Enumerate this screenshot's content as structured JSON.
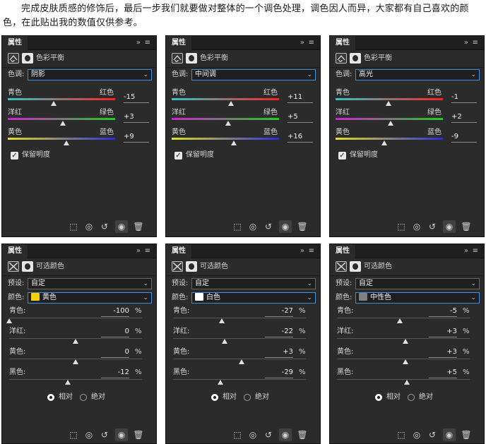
{
  "intro": {
    "text": "完成皮肤质感的修饰后，最后一步我们就要做对整体的一个调色处理，调色因人而异，大家都有自己喜欢的颜色，在此贴出我的数值仅供参考。"
  },
  "colors": {
    "panel_bg": "#2b2b2b",
    "accent_focus": "#3d8de0",
    "yellow_swatch": "#f2d20a",
    "white_swatch": "#ffffff",
    "neutral_swatch": "#808080"
  },
  "panel_common": {
    "tab_title": "属性",
    "collapse_glyph": "»",
    "menu_glyph": "≡",
    "footer_icons": [
      "clip-to-layer-icon",
      "view-previous-state-icon",
      "reset-icon",
      "visibility-eye-icon",
      "delete-icon"
    ]
  },
  "color_balance": {
    "header_title": "色彩平衡",
    "tone_label": "色调:",
    "preserve_label": "保留明度",
    "slider_pairs": [
      {
        "left": "青色",
        "right": "红色"
      },
      {
        "left": "洋红",
        "right": "绿色"
      },
      {
        "left": "黄色",
        "right": "蓝色"
      }
    ],
    "panels": [
      {
        "tone": "阴影",
        "values": [
          "-15",
          "+3",
          "+9"
        ],
        "preserve": true
      },
      {
        "tone": "中间调",
        "values": [
          "+11",
          "+5",
          "+16"
        ],
        "preserve": true
      },
      {
        "tone": "高光",
        "values": [
          "-1",
          "+2",
          "-9"
        ],
        "preserve": true
      }
    ]
  },
  "selective_color": {
    "header_title": "可选颜色",
    "preset_label": "预设:",
    "preset_value": "自定",
    "color_label": "颜色:",
    "slider_labels": [
      "青色:",
      "洋红:",
      "黄色:",
      "黑色:"
    ],
    "percent": "%",
    "relative_label": "相对",
    "absolute_label": "绝对",
    "method": "relative",
    "panels": [
      {
        "color": "黄色",
        "swatch": "yellow",
        "values": [
          "-100",
          "0",
          "0",
          "-12"
        ]
      },
      {
        "color": "白色",
        "swatch": "white",
        "values": [
          "-27",
          "-22",
          "+3",
          "-29"
        ]
      },
      {
        "color": "中性色",
        "swatch": "neutral",
        "values": [
          "-5",
          "+3",
          "+3",
          "+5"
        ]
      }
    ]
  }
}
